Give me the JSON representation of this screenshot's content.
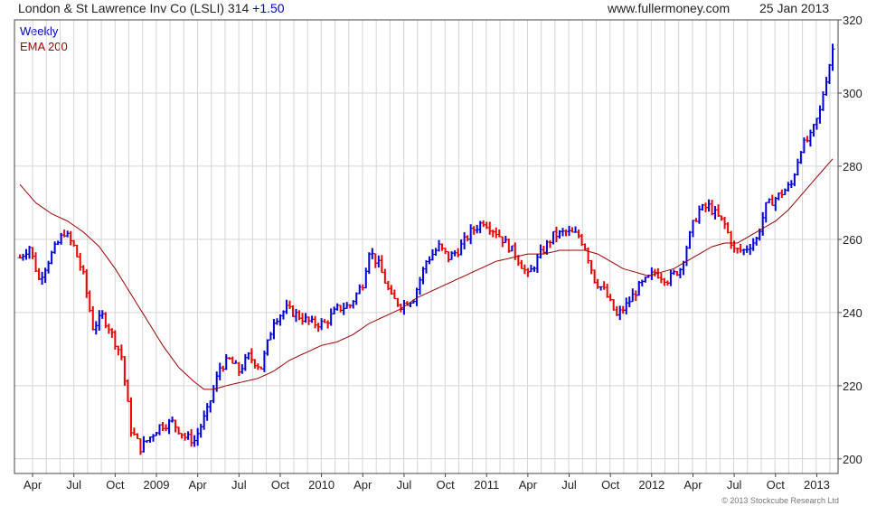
{
  "header": {
    "title": "London & St Lawrence Inv Co (LSLI) 314",
    "change": "+1.50",
    "site": "www.fullermoney.com",
    "date": "25 Jan 2013"
  },
  "legend": {
    "period": "Weekly",
    "ma": "EMA 200"
  },
  "credit": "© 2013 Stockcube Research Ltd",
  "colors": {
    "up": "#0000dd",
    "down": "#ee0000",
    "ema": "#990000",
    "grid": "#d4d4d4",
    "change": "#0000cc"
  },
  "chart_data": {
    "type": "ohlc",
    "y_range": [
      196,
      320
    ],
    "y_ticks": [
      200,
      220,
      240,
      260,
      280,
      300,
      320
    ],
    "x_labels": [
      "Apr",
      "Jul",
      "Oct",
      "2009",
      "Apr",
      "Jul",
      "Oct",
      "2010",
      "Apr",
      "Jul",
      "Oct",
      "2011",
      "Apr",
      "Jul",
      "Oct",
      "2012",
      "Apr",
      "Jul",
      "Oct",
      "2013"
    ],
    "x_label_weeks": [
      4,
      17,
      30,
      43,
      56,
      69,
      82,
      95,
      108,
      121,
      134,
      147,
      160,
      173,
      186,
      199,
      212,
      225,
      238,
      251
    ],
    "week_count": 257,
    "price_anchors": [
      [
        0,
        255
      ],
      [
        3,
        258
      ],
      [
        6,
        249
      ],
      [
        10,
        256
      ],
      [
        14,
        262
      ],
      [
        17,
        258
      ],
      [
        20,
        250
      ],
      [
        23,
        236
      ],
      [
        26,
        239
      ],
      [
        28,
        236
      ],
      [
        32,
        228
      ],
      [
        35,
        208
      ],
      [
        38,
        203
      ],
      [
        41,
        206
      ],
      [
        44,
        209
      ],
      [
        48,
        210
      ],
      [
        52,
        206
      ],
      [
        55,
        205
      ],
      [
        59,
        213
      ],
      [
        63,
        225
      ],
      [
        66,
        227
      ],
      [
        69,
        224
      ],
      [
        72,
        228
      ],
      [
        76,
        225
      ],
      [
        80,
        238
      ],
      [
        84,
        241
      ],
      [
        88,
        239
      ],
      [
        92,
        237
      ],
      [
        96,
        237
      ],
      [
        100,
        241
      ],
      [
        104,
        242
      ],
      [
        108,
        248
      ],
      [
        110,
        257
      ],
      [
        113,
        253
      ],
      [
        117,
        244
      ],
      [
        120,
        242
      ],
      [
        124,
        244
      ],
      [
        128,
        254
      ],
      [
        132,
        258
      ],
      [
        135,
        255
      ],
      [
        138,
        257
      ],
      [
        142,
        262
      ],
      [
        146,
        265
      ],
      [
        150,
        262
      ],
      [
        154,
        258
      ],
      [
        156,
        256
      ],
      [
        160,
        250
      ],
      [
        164,
        256
      ],
      [
        168,
        261
      ],
      [
        172,
        262
      ],
      [
        176,
        261
      ],
      [
        178,
        258
      ],
      [
        181,
        249
      ],
      [
        184,
        246
      ],
      [
        188,
        239
      ],
      [
        191,
        242
      ],
      [
        195,
        247
      ],
      [
        200,
        251
      ],
      [
        204,
        249
      ],
      [
        208,
        252
      ],
      [
        212,
        264
      ],
      [
        214,
        268
      ],
      [
        217,
        269
      ],
      [
        222,
        264
      ],
      [
        225,
        257
      ],
      [
        228,
        257
      ],
      [
        232,
        260
      ],
      [
        235,
        269
      ],
      [
        239,
        272
      ],
      [
        243,
        275
      ],
      [
        246,
        285
      ],
      [
        249,
        288
      ],
      [
        252,
        295
      ],
      [
        253,
        300
      ],
      [
        256,
        312
      ]
    ],
    "ema_anchors": [
      [
        0,
        275
      ],
      [
        5,
        270
      ],
      [
        10,
        267
      ],
      [
        15,
        265
      ],
      [
        20,
        262
      ],
      [
        25,
        258
      ],
      [
        30,
        252
      ],
      [
        35,
        245
      ],
      [
        40,
        238
      ],
      [
        45,
        231
      ],
      [
        50,
        225
      ],
      [
        55,
        221
      ],
      [
        58,
        219
      ],
      [
        61,
        219
      ],
      [
        65,
        220
      ],
      [
        70,
        221
      ],
      [
        75,
        222
      ],
      [
        80,
        224
      ],
      [
        85,
        227
      ],
      [
        90,
        229
      ],
      [
        95,
        231
      ],
      [
        100,
        232
      ],
      [
        105,
        234
      ],
      [
        110,
        237
      ],
      [
        115,
        239
      ],
      [
        120,
        241
      ],
      [
        125,
        244
      ],
      [
        130,
        246
      ],
      [
        135,
        248
      ],
      [
        140,
        250
      ],
      [
        145,
        252
      ],
      [
        150,
        254
      ],
      [
        155,
        255
      ],
      [
        160,
        256
      ],
      [
        165,
        256
      ],
      [
        170,
        257
      ],
      [
        174,
        257
      ],
      [
        178,
        257
      ],
      [
        182,
        256
      ],
      [
        186,
        254
      ],
      [
        190,
        252
      ],
      [
        194,
        251
      ],
      [
        198,
        250
      ],
      [
        202,
        251
      ],
      [
        206,
        252
      ],
      [
        210,
        254
      ],
      [
        214,
        256
      ],
      [
        218,
        258
      ],
      [
        222,
        259
      ],
      [
        226,
        259
      ],
      [
        230,
        261
      ],
      [
        234,
        263
      ],
      [
        238,
        265
      ],
      [
        242,
        268
      ],
      [
        246,
        272
      ],
      [
        250,
        276
      ],
      [
        254,
        280
      ],
      [
        256,
        282
      ]
    ]
  }
}
